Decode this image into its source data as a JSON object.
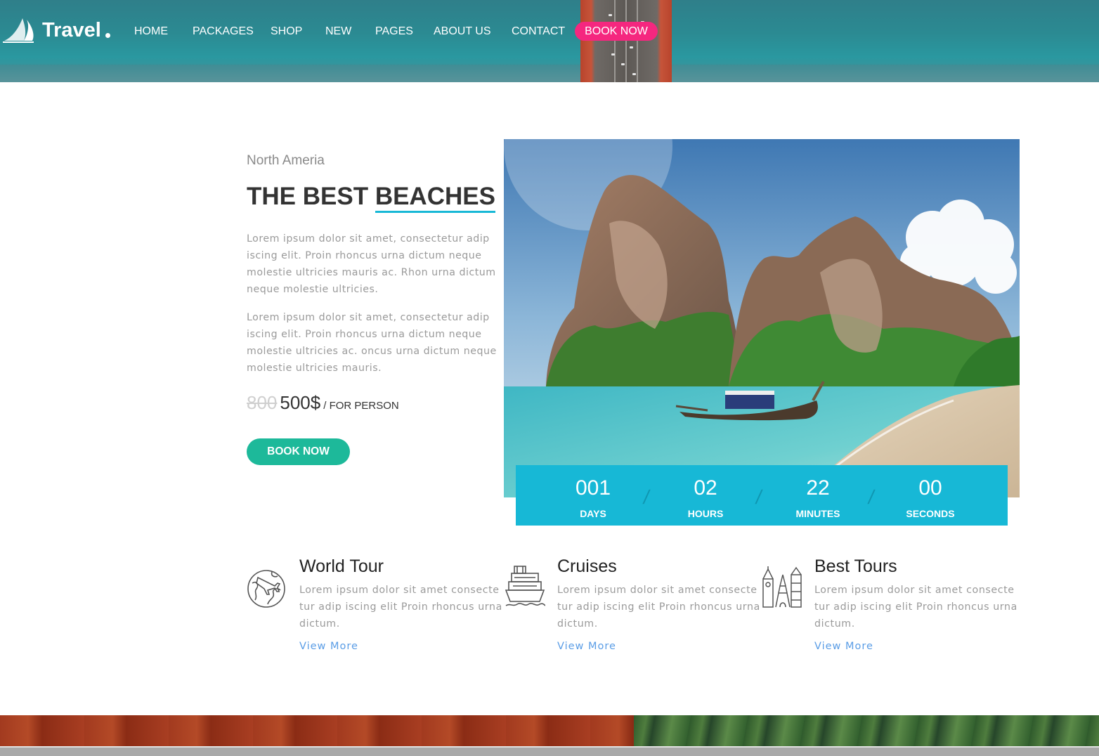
{
  "header": {
    "brand": "Travel",
    "nav": [
      {
        "label": "HOME"
      },
      {
        "label": "PACKAGES"
      },
      {
        "label": "SHOP"
      },
      {
        "label": "NEW"
      },
      {
        "label": "PAGES"
      },
      {
        "label": "ABOUT US"
      },
      {
        "label": "CONTACT"
      }
    ],
    "book_label": "BOOK NOW",
    "accent": "#f5277f"
  },
  "hero": {
    "subtitle": "North Ameria",
    "title_prefix": "THE BEST",
    "title_highlight": "BEACHES",
    "paragraph_1": "Lorem ipsum dolor sit amet, consectetur adip iscing elit. Proin rhoncus urna dictum neque molestie ultricies mauris ac. Rhon urna dictum neque molestie ultricies.",
    "paragraph_2": "Lorem ipsum dolor sit amet, consectetur adip iscing elit. Proin rhoncus urna dictum neque molestie ultricies ac. oncus urna dictum neque molestie ultricies mauris.",
    "price_old": "800",
    "price_new": "500$",
    "price_unit": "/ FOR PERSON",
    "book_label": "BOOK NOW",
    "button_color": "#1db99a",
    "highlight_color": "#17b8d6"
  },
  "countdown": {
    "color": "#17b8d6",
    "units": [
      {
        "value": "001",
        "label": "DAYS"
      },
      {
        "value": "02",
        "label": "HOURS"
      },
      {
        "value": "22",
        "label": "MINUTES"
      },
      {
        "value": "00",
        "label": "SECONDS"
      }
    ],
    "separator": "/"
  },
  "features": [
    {
      "icon": "globe-plane-icon",
      "title": "World Tour",
      "text": "Lorem ipsum dolor sit amet consectetur adip iscing elit Proin rhoncus urna dictum.",
      "link": "View More"
    },
    {
      "icon": "cruise-ship-icon",
      "title": "Cruises",
      "text": "Lorem ipsum dolor sit amet consectetur adip iscing elit Proin rhoncus urna dictum.",
      "link": "View More"
    },
    {
      "icon": "landmarks-icon",
      "title": "Best Tours",
      "text": "Lorem ipsum dolor sit amet consectetur adip iscing elit Proin rhoncus urna dictum.",
      "link": "View More"
    }
  ]
}
